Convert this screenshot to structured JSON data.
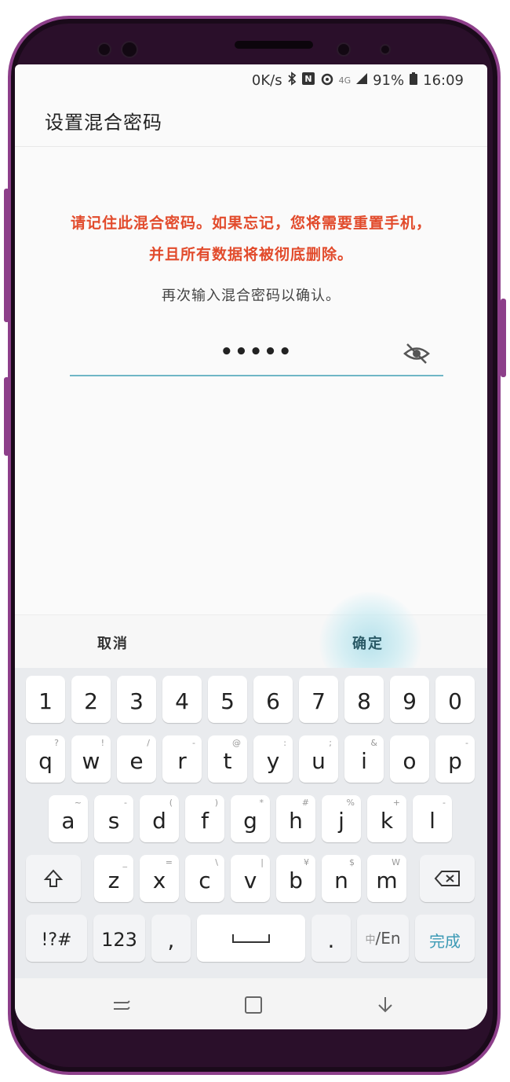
{
  "status_bar": {
    "speed": "0K/s",
    "icons": [
      "bluetooth-icon",
      "nfc-icon",
      "alarm-icon",
      "signal-icon"
    ],
    "network": "4G",
    "battery_percent": "91%",
    "time": "16:09"
  },
  "title": "设置混合密码",
  "warning_line1": "请记住此混合密码。如果忘记，您将需要重置手机，",
  "warning_line2": "并且所有数据将被彻底删除。",
  "confirm_prompt": "再次输入混合密码以确认。",
  "password_value": "•••••",
  "actions": {
    "cancel": "取消",
    "ok": "确定"
  },
  "keyboard": {
    "row_numbers": [
      "1",
      "2",
      "3",
      "4",
      "5",
      "6",
      "7",
      "8",
      "9",
      "0"
    ],
    "row1": [
      {
        "key": "q",
        "hint": "?"
      },
      {
        "key": "w",
        "hint": "!"
      },
      {
        "key": "e",
        "hint": "/"
      },
      {
        "key": "r",
        "hint": "-"
      },
      {
        "key": "t",
        "hint": "@"
      },
      {
        "key": "y",
        "hint": ":"
      },
      {
        "key": "u",
        "hint": ";"
      },
      {
        "key": "i",
        "hint": "&"
      },
      {
        "key": "o",
        "hint": ""
      },
      {
        "key": "p",
        "hint": "-"
      }
    ],
    "row2": [
      {
        "key": "a",
        "hint": "~"
      },
      {
        "key": "s",
        "hint": "-"
      },
      {
        "key": "d",
        "hint": "("
      },
      {
        "key": "f",
        "hint": ")"
      },
      {
        "key": "g",
        "hint": "*"
      },
      {
        "key": "h",
        "hint": "#"
      },
      {
        "key": "j",
        "hint": "%"
      },
      {
        "key": "k",
        "hint": "+"
      },
      {
        "key": "l",
        "hint": "-"
      }
    ],
    "row3": [
      {
        "key": "z",
        "hint": "_"
      },
      {
        "key": "x",
        "hint": "="
      },
      {
        "key": "c",
        "hint": "\\"
      },
      {
        "key": "v",
        "hint": "|"
      },
      {
        "key": "b",
        "hint": "¥"
      },
      {
        "key": "n",
        "hint": "$"
      },
      {
        "key": "m",
        "hint": "W"
      }
    ],
    "symbols_key": "!?#",
    "numbers_key": "123",
    "comma_key": ",",
    "period_key": ".",
    "lang_key_prefix": "中",
    "lang_key_suffix": "/En",
    "done_key": "完成",
    "done_color": "#3c9ab5"
  },
  "colors": {
    "warning": "#e24b2c",
    "input_underline": "#6fb6c6",
    "phone_frame": "#8d3f8a"
  }
}
